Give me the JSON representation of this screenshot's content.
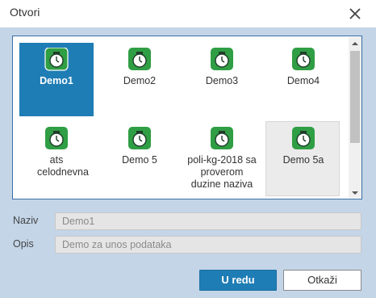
{
  "dialog": {
    "title": "Otvori",
    "close_icon": "close-icon"
  },
  "items": [
    {
      "label": "Demo1",
      "icon": "demo-app-icon",
      "selected": true
    },
    {
      "label": "Demo2",
      "icon": "demo-app-icon"
    },
    {
      "label": "Demo3",
      "icon": "demo-app-icon"
    },
    {
      "label": "Demo4",
      "icon": "demo-app-icon"
    },
    {
      "label": "ats celodnevna",
      "icon": "demo-app-icon"
    },
    {
      "label": "Demo 5",
      "icon": "demo-app-icon"
    },
    {
      "label": "poli-kg-2018 sa proverom duzine naziva",
      "icon": "demo-app-icon"
    },
    {
      "label": "Demo 5a",
      "icon": "demo-app-icon",
      "hovered": true
    }
  ],
  "form": {
    "name_label": "Naziv",
    "name_value": "Demo1",
    "desc_label": "Opis",
    "desc_value": "Demo za unos podataka"
  },
  "buttons": {
    "ok_label": "U redu",
    "cancel_label": "Otkaži"
  },
  "colors": {
    "accent": "#1f7db5",
    "icon_green": "#2f9e44",
    "background": "#c4d5e8"
  }
}
